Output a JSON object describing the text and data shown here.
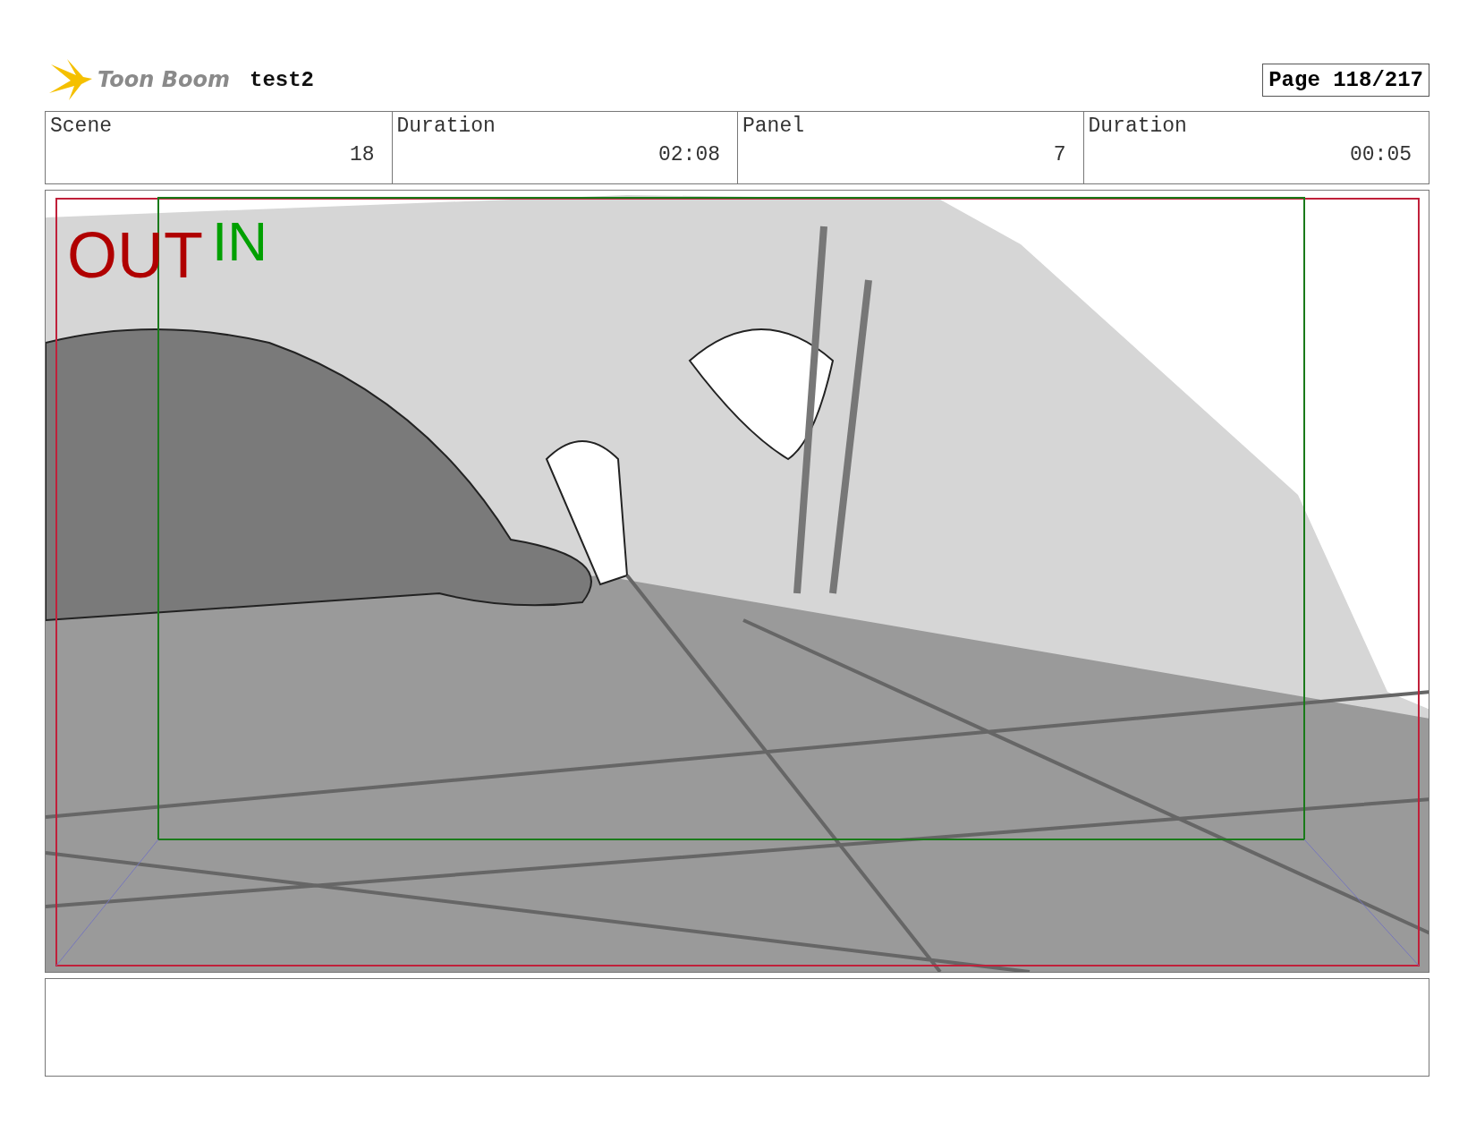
{
  "header": {
    "logo_text": "Toon Boom",
    "project": "test2",
    "page": "Page 118/217"
  },
  "info": [
    {
      "label": "Scene",
      "value": "18"
    },
    {
      "label": "Duration",
      "value": "02:08"
    },
    {
      "label": "Panel",
      "value": "7"
    },
    {
      "label": "Duration",
      "value": "00:05"
    }
  ],
  "panel": {
    "frame_labels": [
      {
        "kind": "out",
        "text": "OUT",
        "color": "#b00000"
      },
      {
        "kind": "in",
        "text": "IN",
        "color": "#00a000"
      }
    ]
  }
}
